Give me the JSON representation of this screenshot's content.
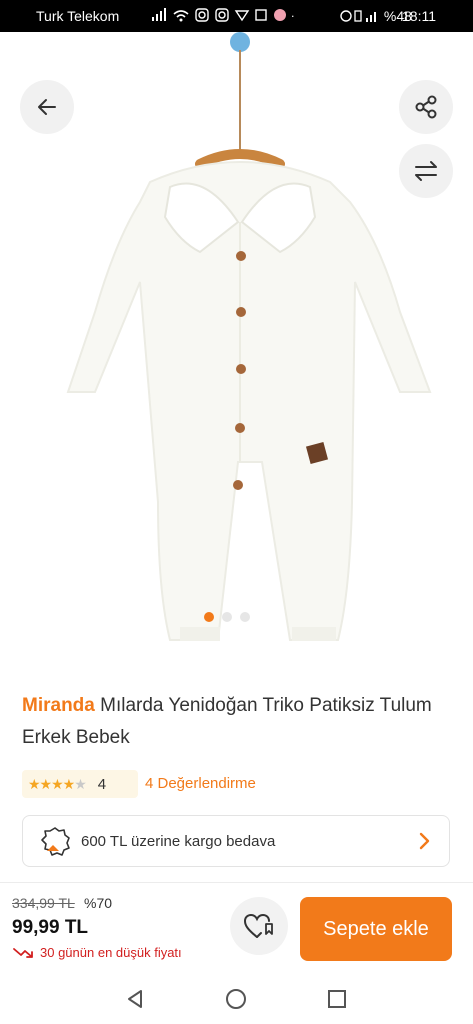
{
  "status_bar": {
    "carrier": "Turk Telekom",
    "battery": "%48",
    "time": "18:11"
  },
  "product": {
    "brand": "Miranda",
    "name": "Mılarda Yenidoğan Triko Patiksiz Tulum Erkek Bebek",
    "image_icon": "white-knit-baby-romper-image",
    "image_count": 3,
    "active_image_index": 0
  },
  "rating": {
    "value": "4",
    "stars": 4,
    "max_stars": 5,
    "reviews_label": "4 Değerlendirme"
  },
  "shipping": {
    "icon": "cargo-truck-icon",
    "text": "600 TL üzerine kargo bedava"
  },
  "pricing": {
    "original_price": "334,99 TL",
    "discount": "%70",
    "price": "99,99 TL",
    "lowest_note": "30 günün en düşük fiyatı"
  },
  "actions": {
    "add_to_cart_label": "Sepete ekle"
  },
  "colors": {
    "accent": "#f27a1a",
    "lowest_red": "#d21f1f",
    "star": "#f5a623"
  }
}
